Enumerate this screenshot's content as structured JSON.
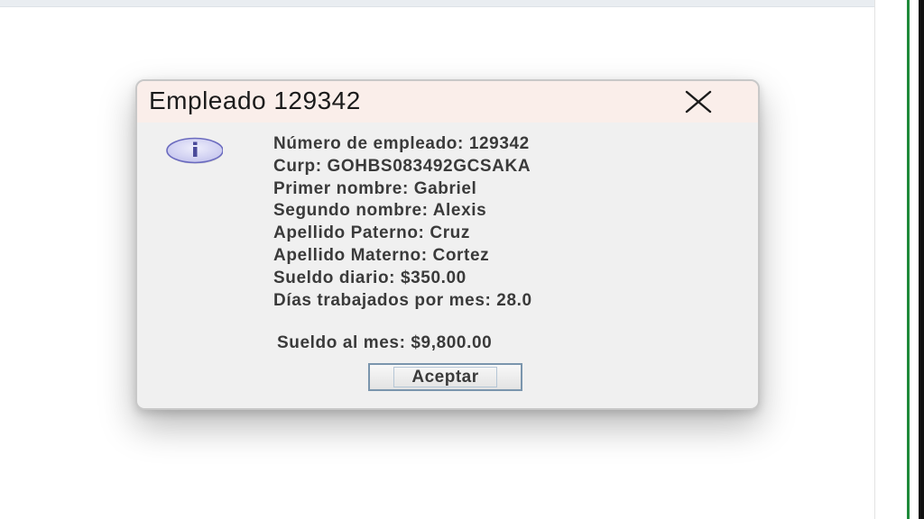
{
  "dialog": {
    "title": "Empleado 129342",
    "close_icon": "close-icon",
    "info_icon": "info-icon",
    "lines": [
      "Número de empleado: 129342",
      "Curp: GOHBS083492GCSAKA",
      "Primer nombre: Gabriel",
      "Segundo nombre: Alexis",
      "Apellido Paterno: Cruz",
      "Apellido Materno: Cortez",
      "Sueldo diario: $350.00",
      "Días trabajados por mes: 28.0"
    ],
    "total": "Sueldo al mes: $9,800.00",
    "accept_label": "Aceptar"
  },
  "colors": {
    "title_bar": "#faeeea",
    "dialog_body": "#f0f0f0",
    "info_icon_fill": "#d5d5f2",
    "info_icon_stroke": "#6b6bbf",
    "button_border": "#7a95ad"
  }
}
